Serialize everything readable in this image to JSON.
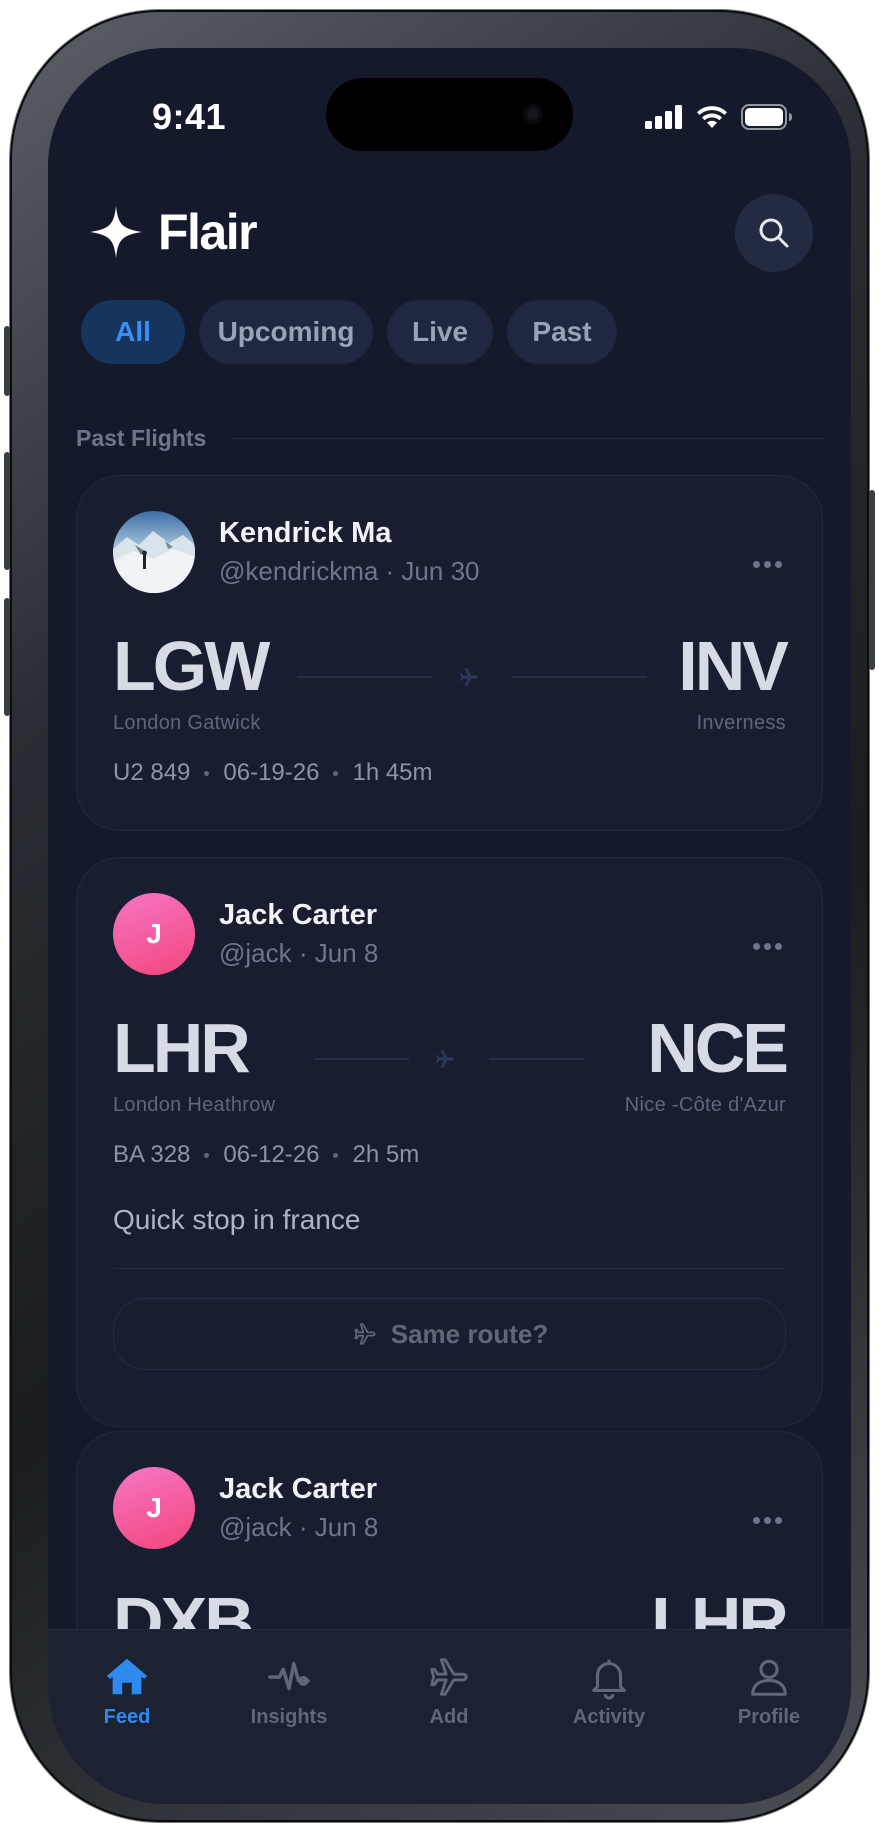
{
  "status_bar": {
    "time": "9:41"
  },
  "header": {
    "brand": "Flair"
  },
  "filters": [
    {
      "label": "All",
      "active": true
    },
    {
      "label": "Upcoming",
      "active": false
    },
    {
      "label": "Live",
      "active": false
    },
    {
      "label": "Past",
      "active": false
    }
  ],
  "section": {
    "title": "Past Flights"
  },
  "posts": [
    {
      "user": {
        "name": "Kendrick Ma",
        "meta": "@kendrickma · Jun 30",
        "avatar": "photo"
      },
      "from": {
        "code": "LGW",
        "city": "London Gatwick"
      },
      "to": {
        "code": "INV",
        "city": "Inverness"
      },
      "flight": "U2 849",
      "date": "06-19-26",
      "duration": "1h 45m"
    },
    {
      "user": {
        "name": "Jack Carter",
        "meta": "@jack · Jun 8",
        "initial": "J"
      },
      "from": {
        "code": "LHR",
        "city": "London Heathrow"
      },
      "to": {
        "code": "NCE",
        "city": "Nice -Côte d'Azur"
      },
      "flight": "BA 328",
      "date": "06-12-26",
      "duration": "2h 5m",
      "caption": "Quick stop in france",
      "action": "Same route?"
    },
    {
      "user": {
        "name": "Jack Carter",
        "meta": "@jack · Jun 8",
        "initial": "J"
      },
      "from": {
        "code": "DXB"
      },
      "to": {
        "code": "LHR"
      }
    }
  ],
  "tabbar": {
    "feed": "Feed",
    "insights": "Insights",
    "add": "Add",
    "activity": "Activity",
    "profile": "Profile"
  },
  "colors": {
    "accent": "#2f8af0",
    "background": "#141a2b",
    "card": "#181e30"
  }
}
